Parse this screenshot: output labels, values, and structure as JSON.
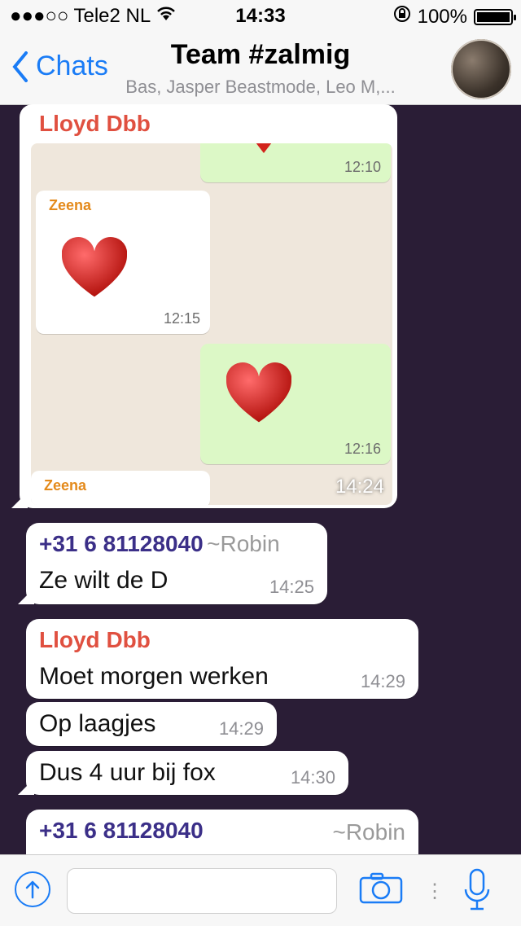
{
  "status": {
    "carrier": "Tele2 NL",
    "time": "14:33",
    "battery": "100%"
  },
  "header": {
    "back_label": "Chats",
    "title": "Team #zalmig",
    "subtitle": "Bas, Jasper Beastmode, Leo M,..."
  },
  "messages": [
    {
      "sender": "Lloyd Dbb",
      "image": {
        "top_time": "12:10",
        "zeena_label": "Zeena",
        "zeena_time": "12:15",
        "green_time": "12:16",
        "zeena_bottom_label": "Zeena",
        "overlay_time": "14:24"
      }
    },
    {
      "sender_number": "+31 6 81128040",
      "sender_alias": "~Robin",
      "text": "Ze wilt de D",
      "time": "14:25"
    },
    {
      "sender": "Lloyd Dbb",
      "text": "Moet morgen werken",
      "time": "14:29"
    },
    {
      "text": "Op laagjes",
      "time": "14:29"
    },
    {
      "text": "Dus 4 uur bij fox",
      "time": "14:30"
    },
    {
      "sender_number": "+31 6 81128040",
      "sender_alias": "~Robin"
    }
  ],
  "icons": {
    "status_signal": "signal-dots-icon",
    "status_wifi": "wifi-icon",
    "status_rotation": "rotation-lock-icon",
    "back": "chevron-left-icon",
    "attach": "upload-icon",
    "camera": "camera-icon",
    "mic": "microphone-icon"
  },
  "colors": {
    "accent": "#1a7cf6",
    "chat_bg": "#2a1d36",
    "lloyd": "#e05040",
    "robin": "#3b2f88"
  }
}
